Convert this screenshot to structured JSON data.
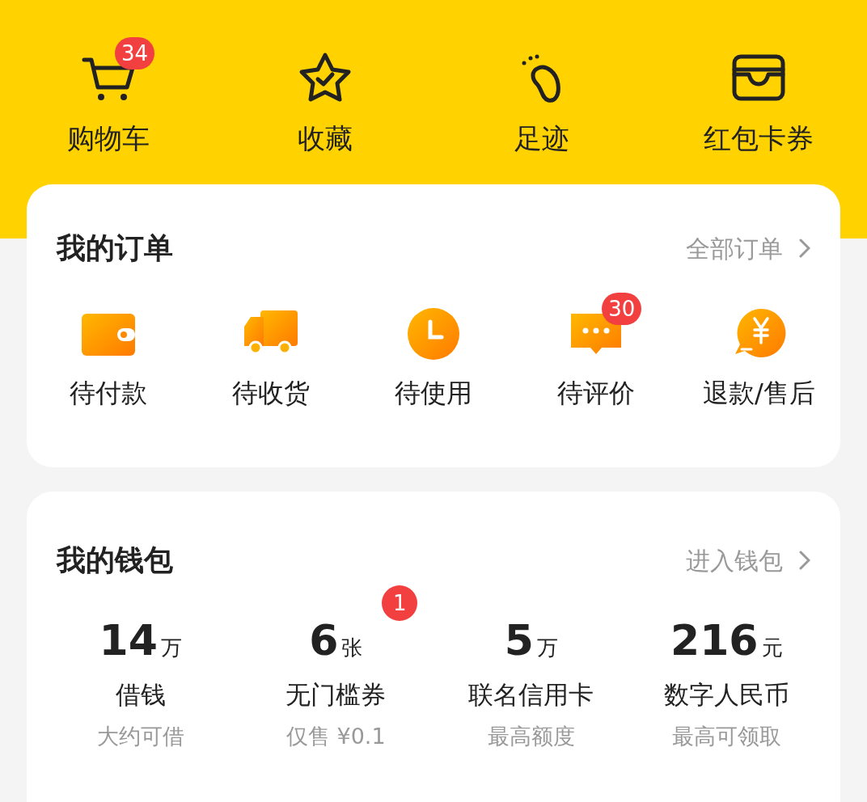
{
  "shortcuts": [
    {
      "label": "购物车",
      "badge": "34"
    },
    {
      "label": "收藏"
    },
    {
      "label": "足迹"
    },
    {
      "label": "红包卡券"
    }
  ],
  "orders": {
    "title": "我的订单",
    "link": "全部订单",
    "items": [
      {
        "label": "待付款"
      },
      {
        "label": "待收货"
      },
      {
        "label": "待使用"
      },
      {
        "label": "待评价",
        "badge": "30"
      },
      {
        "label": "退款/售后"
      }
    ]
  },
  "wallet": {
    "title": "我的钱包",
    "link": "进入钱包",
    "items": [
      {
        "value": "14",
        "unit": "万",
        "label": "借钱",
        "sublabel": "大约可借"
      },
      {
        "value": "6",
        "unit": "张",
        "label": "无门槛券",
        "sublabel": "仅售 ¥0.1",
        "badge": "1"
      },
      {
        "value": "5",
        "unit": "万",
        "label": "联名信用卡",
        "sublabel": "最高额度"
      },
      {
        "value": "216",
        "unit": "元",
        "label": "数字人民币",
        "sublabel": "最高可领取"
      }
    ]
  }
}
